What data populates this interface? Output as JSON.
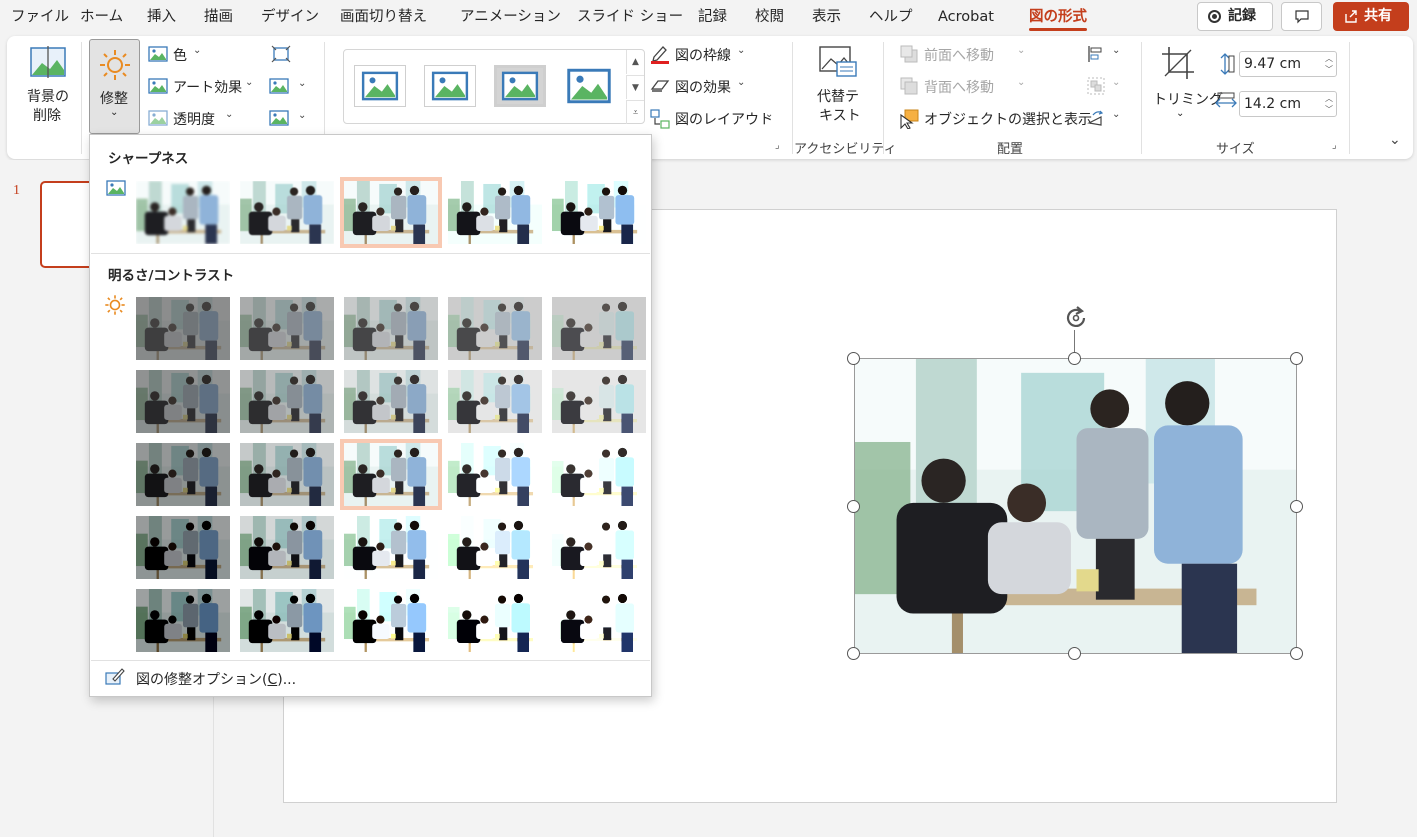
{
  "menu": {
    "items": [
      "ファイル",
      "ホーム",
      "挿入",
      "描画",
      "デザイン",
      "画面切り替え",
      "アニメーション",
      "スライド ショー",
      "記録",
      "校閲",
      "表示",
      "ヘルプ",
      "Acrobat",
      "図の形式"
    ],
    "active_index": 13,
    "record_label": "記録",
    "share_label": "共有"
  },
  "ribbon": {
    "remove_bg_line1": "背景の",
    "remove_bg_line2": "削除",
    "corrections_label": "修整",
    "color_label": "色",
    "art_effects_label": "アート効果",
    "transparency_label": "透明度",
    "border_label": "図の枠線",
    "effects_label": "図の効果",
    "layout_label": "図のレイアウト",
    "alt_text_line1": "代替テ",
    "alt_text_line2": "キスト",
    "accessibility_group": "アクセシビリティ",
    "bring_forward_label": "前面へ移動",
    "send_backward_label": "背面へ移動",
    "selection_pane_label": "オブジェクトの選択と表示",
    "arrange_group": "配置",
    "crop_label": "トリミング",
    "height_value": "9.47 cm",
    "width_value": "14.2 cm",
    "size_group": "サイズ"
  },
  "slides": {
    "current_number": "1"
  },
  "corrections_menu": {
    "sharpness_heading": "シャープネス",
    "brightness_heading": "明るさ/コントラスト",
    "sharpness_selected_index": 2,
    "brightness_rows": 5,
    "brightness_cols": 5,
    "brightness_selected": [
      2,
      2
    ],
    "options_text": "図の修整オプション(",
    "options_key": "C",
    "options_suffix": ")..."
  },
  "colors": {
    "accent": "#c43e1c",
    "selection_outline": "#f8c9b2"
  }
}
